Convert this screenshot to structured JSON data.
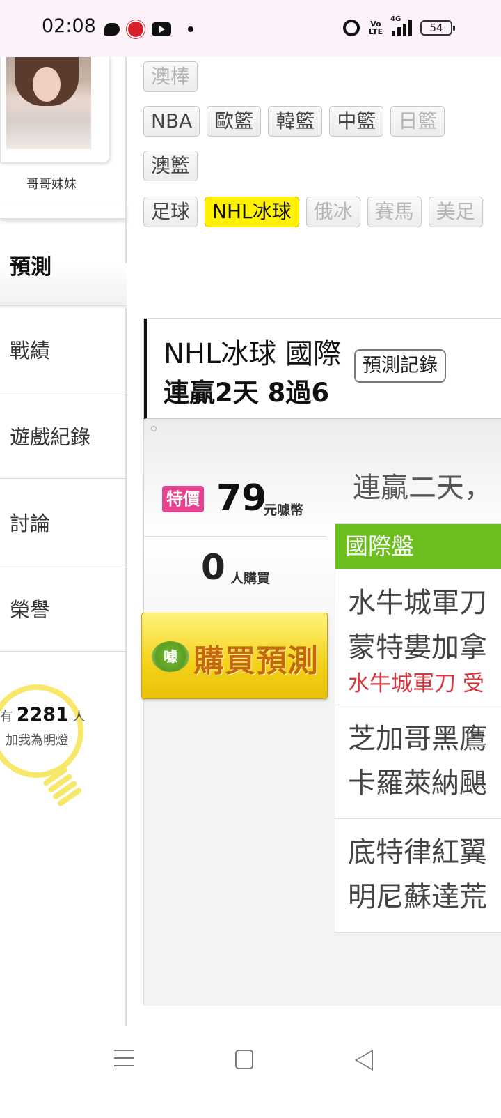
{
  "status_bar": {
    "time": "02:08",
    "icons_left": [
      "message-icon",
      "app-red-icon",
      "youtube-icon",
      "dot-icon"
    ],
    "volte": "Vo LTE",
    "network": "4G",
    "battery": "54"
  },
  "profile": {
    "name": "哥哥妹妹"
  },
  "menu": {
    "title": "預測",
    "items": [
      {
        "label": "戰績"
      },
      {
        "label": "遊戲紀錄"
      },
      {
        "label": "討論"
      },
      {
        "label": "榮譽"
      }
    ]
  },
  "fans": {
    "prefix": "有",
    "count": "2281",
    "suffix": "人",
    "caption": "加我為明燈"
  },
  "tags": {
    "row1": [
      {
        "label": "澳棒",
        "state": "dim"
      }
    ],
    "row2": [
      {
        "label": "NBA",
        "state": "normal"
      },
      {
        "label": "歐籃",
        "state": "normal"
      },
      {
        "label": "韓籃",
        "state": "normal"
      },
      {
        "label": "中籃",
        "state": "normal"
      },
      {
        "label": "日籃",
        "state": "dim"
      }
    ],
    "row3": [
      {
        "label": "澳籃",
        "state": "normal"
      }
    ],
    "row4": [
      {
        "label": "足球",
        "state": "normal"
      },
      {
        "label": "NHL冰球",
        "state": "active"
      },
      {
        "label": "俄冰",
        "state": "dim"
      },
      {
        "label": "賽馬",
        "state": "dim"
      },
      {
        "label": "美足",
        "state": "dim"
      }
    ]
  },
  "prediction": {
    "title": "NHL冰球 國際",
    "streak": "連贏2天 8過6",
    "record_button": "預測記錄",
    "marquee": "連贏二天，",
    "special_badge": "特價",
    "price": "79",
    "price_unit": "元噱幣",
    "buyers": "0",
    "buyers_unit": "人購買",
    "buy_button": "購買預測",
    "buy_logo": "噱",
    "market_header": "國際盤",
    "games": [
      {
        "teams": [
          "水牛城軍刀",
          "蒙特婁加拿"
        ],
        "note": "水牛城軍刀 受"
      },
      {
        "teams": [
          "芝加哥黑鷹",
          "卡羅萊納颶"
        ],
        "note": ""
      },
      {
        "teams": [
          "底特律紅翼",
          "明尼蘇達荒"
        ],
        "note": ""
      }
    ]
  },
  "colors": {
    "active_tag": "#fff200",
    "market_header": "#6cbf1f",
    "special_badge": "#e8418f",
    "note_text": "#d8343e",
    "buy_button": "#f4d21a"
  }
}
